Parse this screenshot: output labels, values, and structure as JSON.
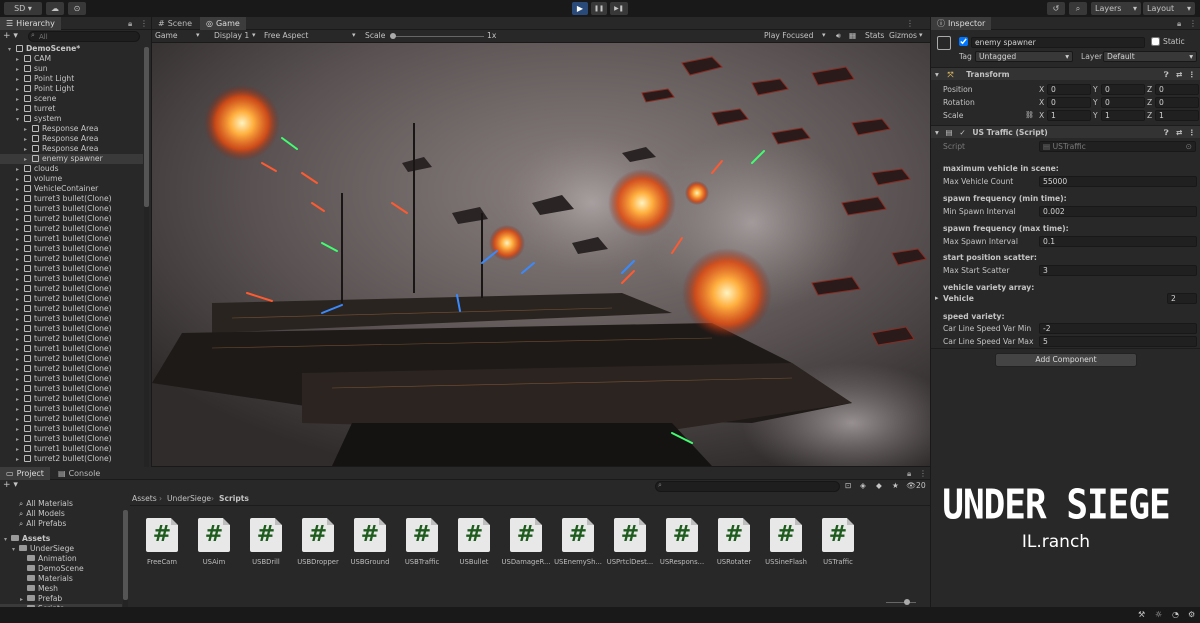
{
  "toolbar": {
    "account": "SD ▾",
    "cloud": "☁",
    "collab": "⊙",
    "play": "▶",
    "pause": "❚❚",
    "step": "▶❚",
    "history": "↺",
    "search": "⌕",
    "layers": "Layers",
    "layout": "Layout"
  },
  "hierarchy": {
    "tab": "Hierarchy",
    "add": "+ ▾",
    "search_placeholder": "All",
    "items": [
      {
        "label": "DemoScene*",
        "indent": 0
      },
      {
        "label": "CAM",
        "indent": 1
      },
      {
        "label": "sun",
        "indent": 1
      },
      {
        "label": "Point Light",
        "indent": 1
      },
      {
        "label": "Point Light",
        "indent": 1
      },
      {
        "label": "scene",
        "indent": 1
      },
      {
        "label": "turret",
        "indent": 1
      },
      {
        "label": "system",
        "indent": 1
      },
      {
        "label": "Response Area",
        "indent": 2
      },
      {
        "label": "Response Area",
        "indent": 2
      },
      {
        "label": "Response Area",
        "indent": 2
      },
      {
        "label": "enemy spawner",
        "indent": 2
      },
      {
        "label": "clouds",
        "indent": 1
      },
      {
        "label": "volume",
        "indent": 1
      },
      {
        "label": "VehicleContainer",
        "indent": 1
      },
      {
        "label": "turret3 bullet(Clone)",
        "indent": 1
      },
      {
        "label": "turret3 bullet(Clone)",
        "indent": 1
      },
      {
        "label": "turret2 bullet(Clone)",
        "indent": 1
      },
      {
        "label": "turret2 bullet(Clone)",
        "indent": 1
      },
      {
        "label": "turret1 bullet(Clone)",
        "indent": 1
      },
      {
        "label": "turret3 bullet(Clone)",
        "indent": 1
      },
      {
        "label": "turret2 bullet(Clone)",
        "indent": 1
      },
      {
        "label": "turret3 bullet(Clone)",
        "indent": 1
      },
      {
        "label": "turret3 bullet(Clone)",
        "indent": 1
      },
      {
        "label": "turret2 bullet(Clone)",
        "indent": 1
      },
      {
        "label": "turret2 bullet(Clone)",
        "indent": 1
      },
      {
        "label": "turret2 bullet(Clone)",
        "indent": 1
      },
      {
        "label": "turret3 bullet(Clone)",
        "indent": 1
      },
      {
        "label": "turret3 bullet(Clone)",
        "indent": 1
      },
      {
        "label": "turret2 bullet(Clone)",
        "indent": 1
      },
      {
        "label": "turret1 bullet(Clone)",
        "indent": 1
      },
      {
        "label": "turret2 bullet(Clone)",
        "indent": 1
      },
      {
        "label": "turret2 bullet(Clone)",
        "indent": 1
      },
      {
        "label": "turret3 bullet(Clone)",
        "indent": 1
      },
      {
        "label": "turret3 bullet(Clone)",
        "indent": 1
      },
      {
        "label": "turret2 bullet(Clone)",
        "indent": 1
      },
      {
        "label": "turret3 bullet(Clone)",
        "indent": 1
      },
      {
        "label": "turret2 bullet(Clone)",
        "indent": 1
      },
      {
        "label": "turret3 bullet(Clone)",
        "indent": 1
      },
      {
        "label": "turret3 bullet(Clone)",
        "indent": 1
      },
      {
        "label": "turret1 bullet(Clone)",
        "indent": 1
      },
      {
        "label": "turret2 bullet(Clone)",
        "indent": 1
      }
    ]
  },
  "scene": {
    "tab_scene": "Scene",
    "tab_game": "Game",
    "game": "Game",
    "display": "Display 1",
    "aspect": "Free Aspect",
    "scale_label": "Scale",
    "scale_value": "1x",
    "play_focused": "Play Focused",
    "stats": "Stats",
    "gizmos": "Gizmos"
  },
  "inspector": {
    "tab": "Inspector",
    "object_name": "enemy spawner",
    "static": "Static",
    "tag_label": "Tag",
    "tag": "Untagged",
    "layer_label": "Layer",
    "layer": "Default",
    "transform": {
      "title": "Transform",
      "position": "Position",
      "rotation": "Rotation",
      "scale": "Scale",
      "pos": [
        "0",
        "0",
        "0"
      ],
      "rot": [
        "0",
        "0",
        "0"
      ],
      "scl": [
        "1",
        "1",
        "1"
      ]
    },
    "script": {
      "title": "US Traffic (Script)",
      "script_label": "Script",
      "script_value": "USTraffic",
      "fields": [
        {
          "header": "maximum vehicle in scene:",
          "label": "Max Vehicle Count",
          "value": "55000"
        },
        {
          "header": "spawn frequency (min time):",
          "label": "Min Spawn Interval",
          "value": "0.002"
        },
        {
          "header": "spawn frequency (max time):",
          "label": "Max Spawn Interval",
          "value": "0.1"
        },
        {
          "header": "start position scatter:",
          "label": "Max Start Scatter",
          "value": "3"
        },
        {
          "header": "vehicle variety array:",
          "label": "Vehicle",
          "value": "2"
        },
        {
          "header": "speed variety:",
          "label": "Car Line Speed Var Min",
          "value": "-2"
        },
        {
          "header": "",
          "label": "Car Line Speed Var Max",
          "value": "5"
        }
      ]
    },
    "add_component": "Add Component"
  },
  "project": {
    "tab_project": "Project",
    "tab_console": "Console",
    "add": "+ ▾",
    "count": "20",
    "breadcrumb": [
      "Assets",
      "UnderSiege",
      "Scripts"
    ],
    "tree": [
      {
        "label": "All Materials",
        "indent": 1,
        "folder": false
      },
      {
        "label": "All Models",
        "indent": 1,
        "folder": false
      },
      {
        "label": "All Prefabs",
        "indent": 1,
        "folder": false
      },
      {
        "label": "Assets",
        "indent": 0,
        "folder": true
      },
      {
        "label": "UnderSiege",
        "indent": 1,
        "folder": true
      },
      {
        "label": "Animation",
        "indent": 2,
        "folder": true
      },
      {
        "label": "DemoScene",
        "indent": 2,
        "folder": true
      },
      {
        "label": "Materials",
        "indent": 2,
        "folder": true
      },
      {
        "label": "Mesh",
        "indent": 2,
        "folder": true
      },
      {
        "label": "Prefab",
        "indent": 2,
        "folder": true
      },
      {
        "label": "Scripts",
        "indent": 2,
        "folder": true
      }
    ],
    "assets": [
      "FreeCam",
      "USAim",
      "USBDrill",
      "USBDropper",
      "USBGround",
      "USBTraffic",
      "USBullet",
      "USDamageR...",
      "USEnemySh...",
      "USPrtclDest...",
      "USRespons...",
      "USRotater",
      "USSineFlash",
      "USTraffic"
    ],
    "file_glyph": "#"
  },
  "logo": {
    "title": "UNDER SIEGE",
    "subtitle": "IL.ranch"
  },
  "colors": {
    "accent": "#2a4a7a",
    "panel": "#282828",
    "background": "#191919",
    "explosion": "#ff8a2a"
  }
}
